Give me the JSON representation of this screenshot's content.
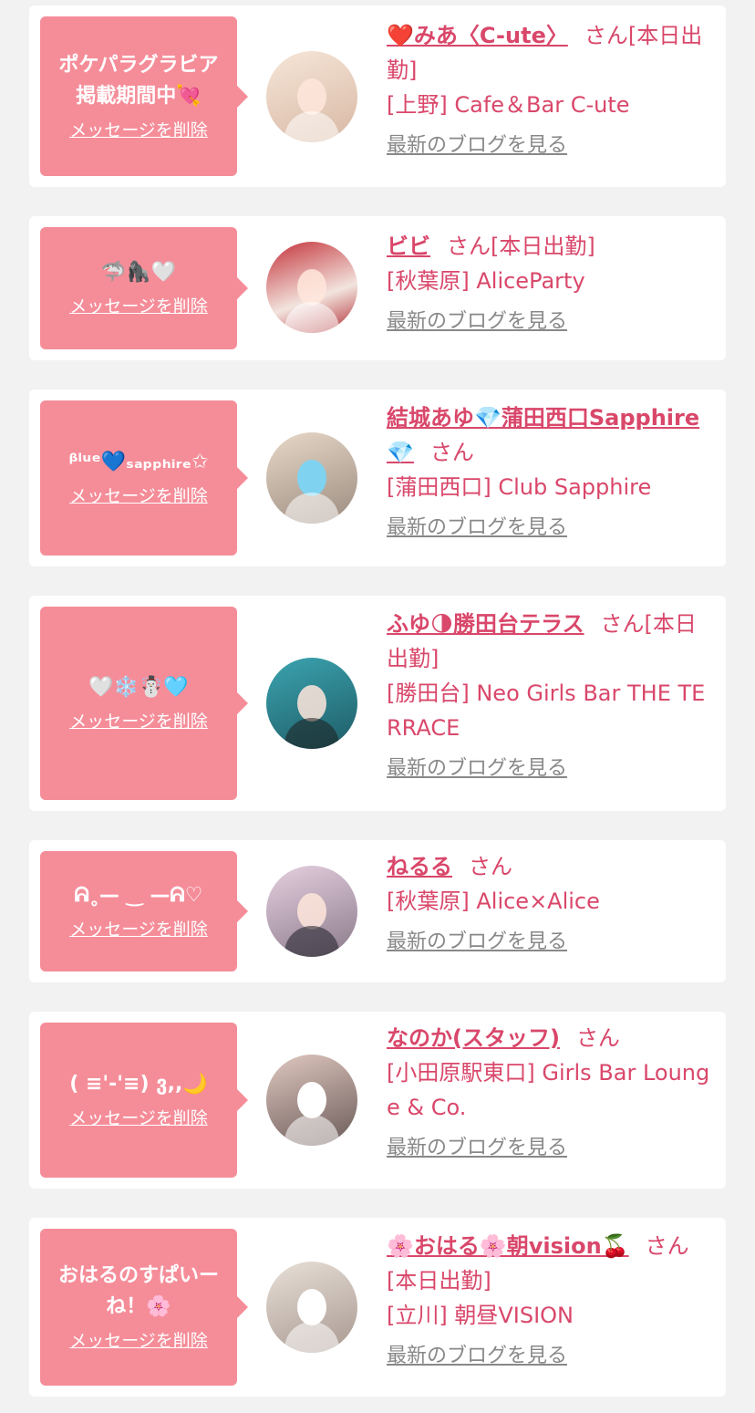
{
  "common": {
    "delete_label": "メッセージを削除",
    "san_label": "さん",
    "blog_label": "最新のブログを見る"
  },
  "colors": {
    "accent": "#f58d99",
    "link": "#d9476a",
    "muted": "#888888",
    "background": "#f2f2f2"
  },
  "items": [
    {
      "message": "ポケパラグラビア\n掲載期間中💘",
      "name": "❤️みあ〈C-ute〉",
      "san_suffix": "さん[本日出勤]",
      "location": "[上野] Cafe＆Bar C-ute"
    },
    {
      "message": "🦈🦍🤍",
      "name": "ビビ",
      "san_suffix": "さん[本日出勤]",
      "location": "[秋葉原] AliceParty"
    },
    {
      "message": "ᵝˡᵘᵉ💙ₛₐₚₚₕᵢᵣₑ✩",
      "name": "結城あゆ💎蒲田西口Sapphire💎",
      "san_suffix": "さん",
      "location": "[蒲田西口] Club Sapphire"
    },
    {
      "message": "🤍❄️☃️🩵",
      "name": "ふゆ🌗勝田台テラス",
      "san_suffix": "さん[本日出勤]",
      "location": "[勝田台] Neo Girls Bar THE TERRACE"
    },
    {
      "message": "ᕱ˳— ‿ —ᕱ♡",
      "name": "ねるる",
      "san_suffix": "さん",
      "location": "[秋葉原] Alice×Alice"
    },
    {
      "message": "( ≡'-'≡) ვ,,🌙",
      "name": "なのか(スタッフ)",
      "san_suffix": "さん",
      "location": "[小田原駅東口] Girls Bar Lounge & Co."
    },
    {
      "message": "おはるのすぱいー\nね！🌸",
      "name": "🌸おはる🌸朝vision🍒",
      "san_suffix": "さん",
      "status_line": "[本日出勤]",
      "location": "[立川] 朝昼VISION"
    }
  ]
}
